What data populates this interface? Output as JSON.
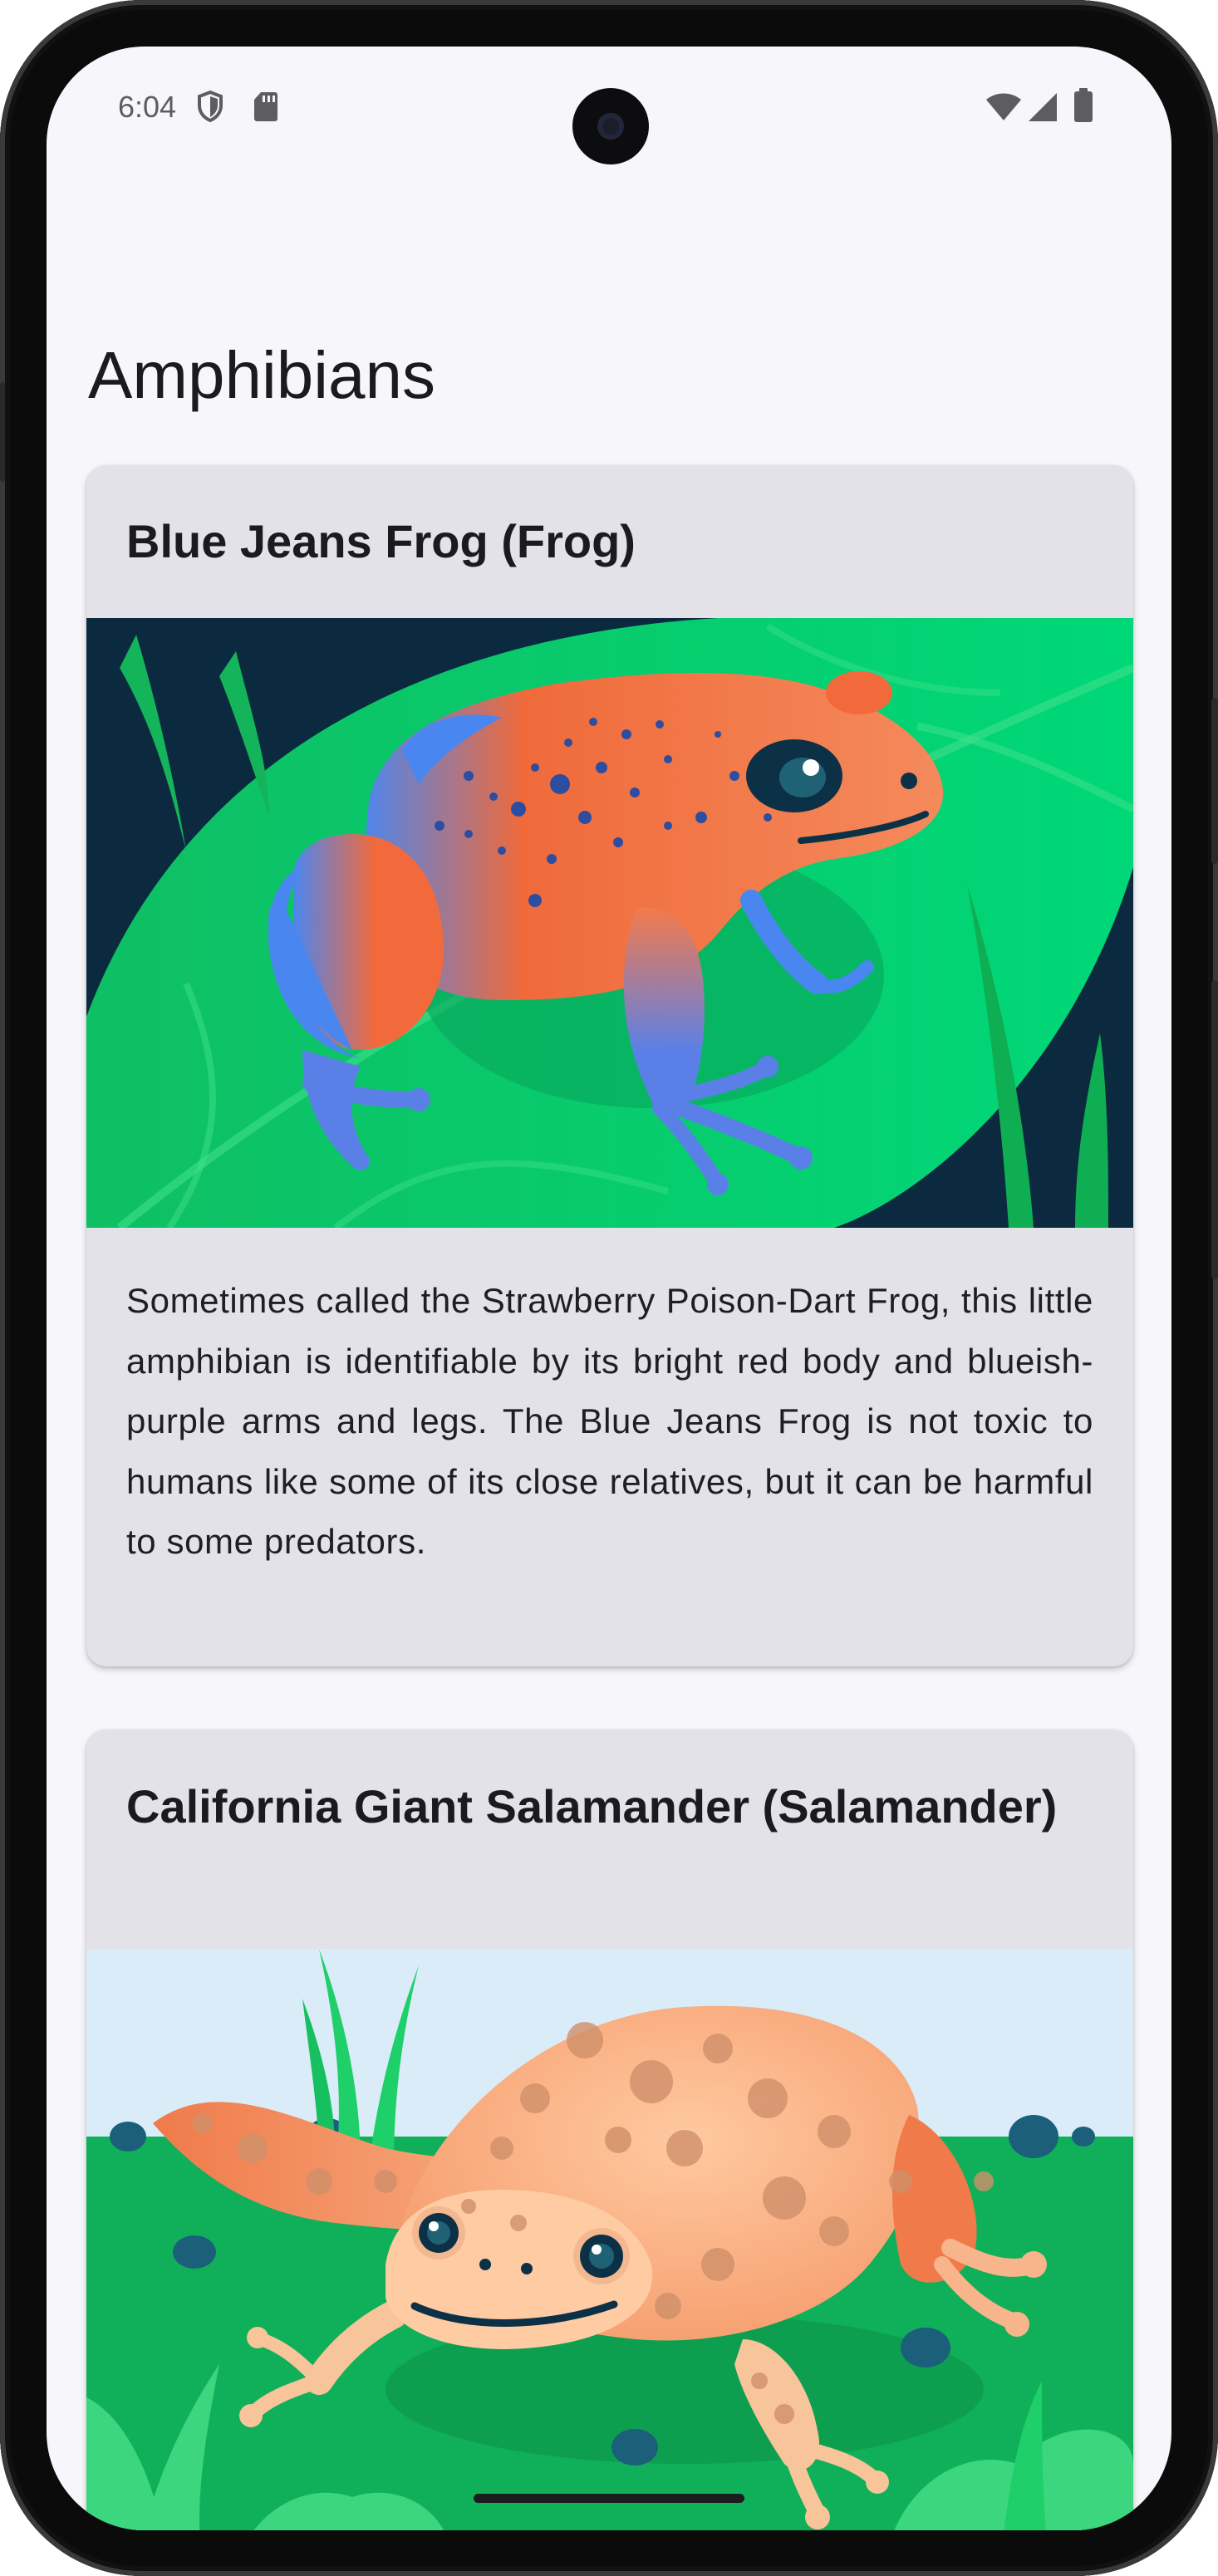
{
  "status_bar": {
    "time": "6:04",
    "left_icons": [
      "shield-icon",
      "sd-card-icon"
    ],
    "right_icons": [
      "wifi-icon",
      "signal-icon",
      "battery-icon"
    ]
  },
  "page": {
    "title": "Amphibians"
  },
  "cards": [
    {
      "title": "Blue Jeans Frog (Frog)",
      "image": "blue-jeans-frog-illustration",
      "description": "Sometimes called the Strawberry Poison-Dart Frog, this little amphibian is identifiable by its bright red body and blueish-purple arms and legs. The Blue Jeans Frog is not toxic to humans like some of its close relatives, but it can be harmful to some predators."
    },
    {
      "title": "California Giant Salamander (Salamander)",
      "image": "california-giant-salamander-illustration"
    }
  ],
  "colors": {
    "screen_background": "#f6f6fb",
    "card_background": "#e3e2e8",
    "frog_orange": "#f26a3c",
    "frog_blue": "#4a86f0",
    "leaf_green": "#0fcf6f",
    "night_navy": "#0c2a3f"
  }
}
